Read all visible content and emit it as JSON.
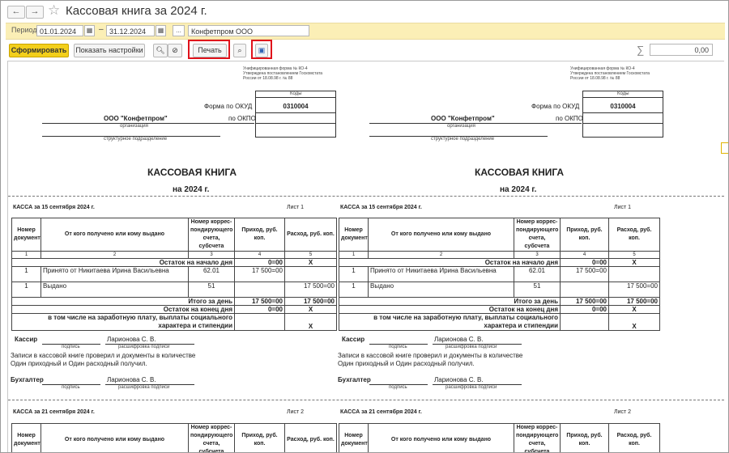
{
  "window": {
    "title": "Кассовая книга за 2024 г.",
    "back_icon": "arrow-left-icon",
    "forward_icon": "arrow-right-icon",
    "star_icon": "star-outline-icon"
  },
  "period": {
    "label": "Период:",
    "from": "01.01.2024",
    "separator": "–",
    "to": "31.12.2024",
    "more_label": "...",
    "organization": "Конфетпром ООО"
  },
  "toolbar": {
    "generate_label": "Сформировать",
    "settings_label": "Показать настройки",
    "print_label": "Печать",
    "sum_symbol": "∑",
    "sum_value": "0,00"
  },
  "form": {
    "header_note": "Унифицированная форма № КО-4\nУтверждена постановлением Госкомстата\nРоссии от 18.08.98 г. № 88",
    "codes_label": "Коды",
    "okud_label": "Форма по ОКУД",
    "okud_code": "0310004",
    "okpo_label": "по ОКПО",
    "organization": "ООО \"Конфетпром\"",
    "organization_caption": "организация",
    "division_caption": "структурное подразделение",
    "book_title": "КАССОВАЯ КНИГА",
    "year_title": "на 2024 г."
  },
  "pages": [
    {
      "header": "КАССА за 15 сентября 2024 г.",
      "sheet": "Лист 1",
      "columns": [
        "Номер документа",
        "От кого получено или кому выдано",
        "Номер коррес-пондирующего счета, субсчета",
        "Приход, руб. коп.",
        "Расход, руб. коп."
      ],
      "col_numbers": [
        "1",
        "2",
        "3",
        "4",
        "5"
      ],
      "opening_label": "Остаток на начало дня",
      "opening_in": "0=00",
      "opening_out": "X",
      "rows": [
        {
          "doc": "1",
          "who": "Принято от Никитаева Ирина Васильевна",
          "account": "62.01",
          "income": "17 500=00",
          "expense": ""
        },
        {
          "doc": "1",
          "who": "Выдано",
          "account": "51",
          "income": "",
          "expense": "17 500=00"
        }
      ],
      "total_label": "Итого за день",
      "total_in": "17 500=00",
      "total_out": "17 500=00",
      "closing_label": "Остаток на конец  дня",
      "closing_in": "0=00",
      "closing_out": "X",
      "salary_label": "в том числе на заработную плату, выплаты социального характера и стипендии",
      "salary_out": "X",
      "cashier_label": "Кассир",
      "cashier_name": "Ларионова С. В.",
      "signature_caption": "подпись",
      "decoding_caption": "расшифровка подписи",
      "records_text1": "Записи в кассовой книге проверил и документы в количестве",
      "records_text2": "Один приходный и Один расходный получил.",
      "accountant_label": "Бухгалтер",
      "accountant_name": "Ларионова С. В."
    },
    {
      "header": "КАССА за 21 сентября 2024 г.",
      "sheet": "Лист 2"
    }
  ]
}
